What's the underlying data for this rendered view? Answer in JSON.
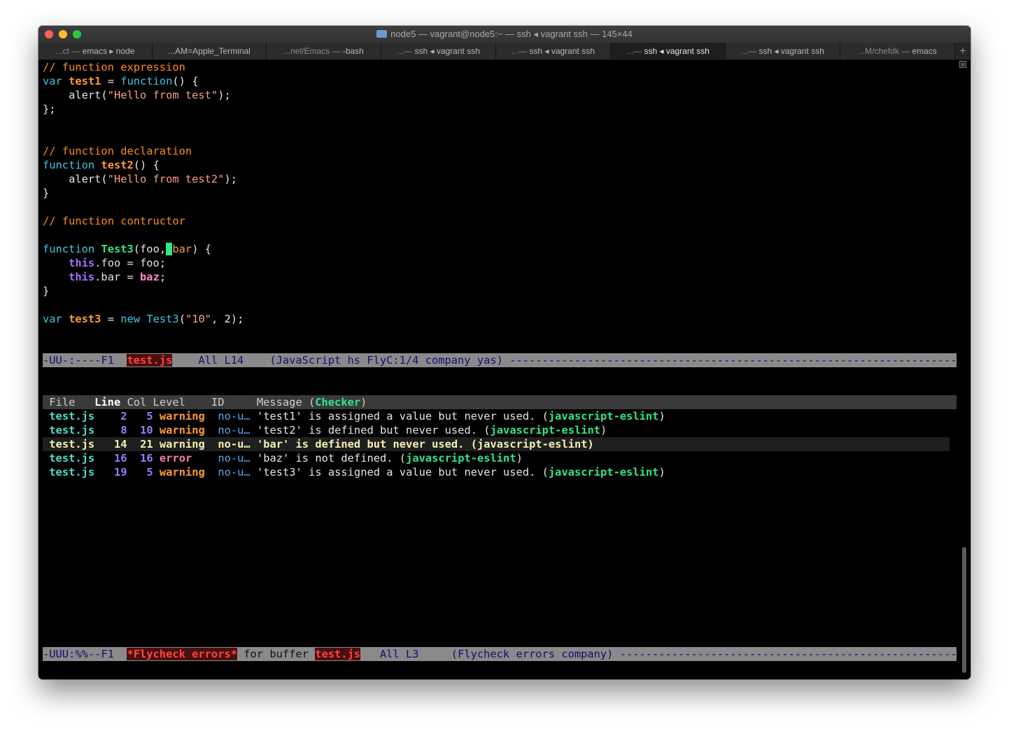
{
  "window": {
    "title": "node5 — vagrant@node5:~ — ssh ◂ vagrant ssh — 145×44"
  },
  "tabs": [
    {
      "prefix": "...ct — ",
      "label": "emacs ▸ node"
    },
    {
      "prefix": "...AM=Apple_Terminal",
      "label": ""
    },
    {
      "prefix": "...nel/Emacs — ",
      "label": "-bash"
    },
    {
      "prefix": "...— ",
      "label": "ssh ◂ vagrant ssh"
    },
    {
      "prefix": "...— ",
      "label": "ssh ◂ vagrant ssh"
    },
    {
      "prefix": "...— ",
      "label": "ssh ◂ vagrant ssh"
    },
    {
      "prefix": "...— ",
      "label": "ssh ◂ vagrant ssh"
    },
    {
      "prefix": "...M/chefdk — ",
      "label": "emacs"
    }
  ],
  "tab_add_label": "+",
  "code": {
    "c1": "// function expression",
    "l2": {
      "kw": "var",
      "name": "test1",
      "mid": " = ",
      "fn": "function",
      "rest": "() {"
    },
    "l3": {
      "pre": "    alert(",
      "str": "\"Hello from test\"",
      "post": ");"
    },
    "l4": "};",
    "c2": "// function declaration",
    "l7": {
      "kw": "function",
      "name": "test2",
      "rest": "() {"
    },
    "l8": {
      "pre": "    alert(",
      "str": "\"Hello from test2\"",
      "post": ");"
    },
    "l9": "}",
    "c3": "// function contructor",
    "l13": {
      "kw": "function",
      "name": "Test3",
      "a": "(foo,",
      "cursor": " ",
      "bar": "bar",
      "rest": ") {"
    },
    "l14": {
      "pre": "    ",
      "this": "this",
      "rest": ".foo = foo;"
    },
    "l15": {
      "pre": "    ",
      "this": "this",
      "mid": ".bar = ",
      "baz": "baz",
      "post": ";"
    },
    "l16": "}",
    "l18": {
      "kw": "var",
      "name": "test3",
      "mid": " = ",
      "new": "new",
      "ctor": "Test3",
      "a": "(",
      "str": "\"10\"",
      "post": ", 2);"
    }
  },
  "modeline1": {
    "pre": "-UU-:----F1  ",
    "buffer": "test.js",
    "post": "    All L14    (JavaScript hs FlyC:1/4 company yas) ",
    "dashes": "-------------------------------------------------------------------------------"
  },
  "errors_header": {
    "file": " File   ",
    "line": "Line",
    "col": " Col",
    "level": " Level    ",
    "id": "ID     ",
    "message": "Message (",
    "checker": "Checker",
    "close": ")"
  },
  "errors": [
    {
      "file": "test.js",
      "line": "2",
      "col": "5",
      "level": "warning",
      "id": "no-u…",
      "message": "'test1' is assigned a value but never used. (",
      "checker": "javascript-eslint",
      "close": ")"
    },
    {
      "file": "test.js",
      "line": "8",
      "col": "10",
      "level": "warning",
      "id": "no-u…",
      "message": "'test2' is defined but never used. (",
      "checker": "javascript-eslint",
      "close": ")"
    },
    {
      "file": "test.js",
      "line": "14",
      "col": "21",
      "level": "warning",
      "id": "no-u…",
      "message": "'bar' is defined but never used. (",
      "checker": "javascript-eslint",
      "close": ")"
    },
    {
      "file": "test.js",
      "line": "16",
      "col": "16",
      "level": "error",
      "id": "no-u…",
      "message": "'baz' is not defined. (",
      "checker": "javascript-eslint",
      "close": ")"
    },
    {
      "file": "test.js",
      "line": "19",
      "col": "5",
      "level": "warning",
      "id": "no-u…",
      "message": "'test3' is assigned a value but never used. (",
      "checker": "javascript-eslint",
      "close": ")"
    }
  ],
  "modeline2": {
    "pre": "-UUU:%%--F1  ",
    "buffer1": "*Flycheck errors*",
    "mid": " for buffer ",
    "buffer2": "test.js",
    "post": "   All L3     (Flycheck errors company) ",
    "dashes": "------------------------------------------------------------"
  }
}
